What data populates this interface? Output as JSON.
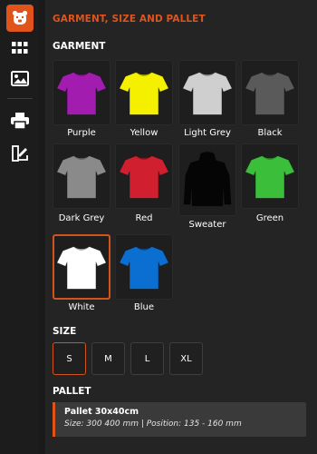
{
  "colors": {
    "accent": "#e0541c",
    "background": "#242424",
    "sidebar": "#1c1c1c"
  },
  "sidebar": {
    "items": [
      {
        "icon": "bear-logo-icon"
      },
      {
        "icon": "grid-apps-icon"
      },
      {
        "icon": "image-icon"
      },
      {
        "icon": "printer-icon"
      },
      {
        "icon": "swatch-brush-icon"
      }
    ]
  },
  "panel": {
    "title": "GARMENT, SIZE AND PALLET"
  },
  "garment": {
    "label": "GARMENT",
    "items": [
      {
        "name": "Purple",
        "color": "#a21caf",
        "type": "tshirt"
      },
      {
        "name": "Yellow",
        "color": "#f5f000",
        "type": "tshirt"
      },
      {
        "name": "Light Grey",
        "color": "#cfcfcf",
        "type": "tshirt"
      },
      {
        "name": "Black",
        "color": "#5a5a5a",
        "type": "tshirt"
      },
      {
        "name": "Dark Grey",
        "color": "#8a8a8a",
        "type": "tshirt"
      },
      {
        "name": "Red",
        "color": "#d01f2e",
        "type": "tshirt"
      },
      {
        "name": "Sweater",
        "color": "#050505",
        "type": "hoodie"
      },
      {
        "name": "Green",
        "color": "#3bbf3a",
        "type": "tshirt"
      },
      {
        "name": "White",
        "color": "#ffffff",
        "type": "tshirt"
      },
      {
        "name": "Blue",
        "color": "#0a6fd0",
        "type": "tshirt"
      }
    ],
    "selected": "White"
  },
  "size": {
    "label": "SIZE",
    "options": [
      "S",
      "M",
      "L",
      "XL"
    ],
    "selected": "S"
  },
  "pallet": {
    "label": "PALLET",
    "name": "Pallet 30x40cm",
    "info": "Size: 300 400 mm | Position: 135 - 160 mm"
  }
}
